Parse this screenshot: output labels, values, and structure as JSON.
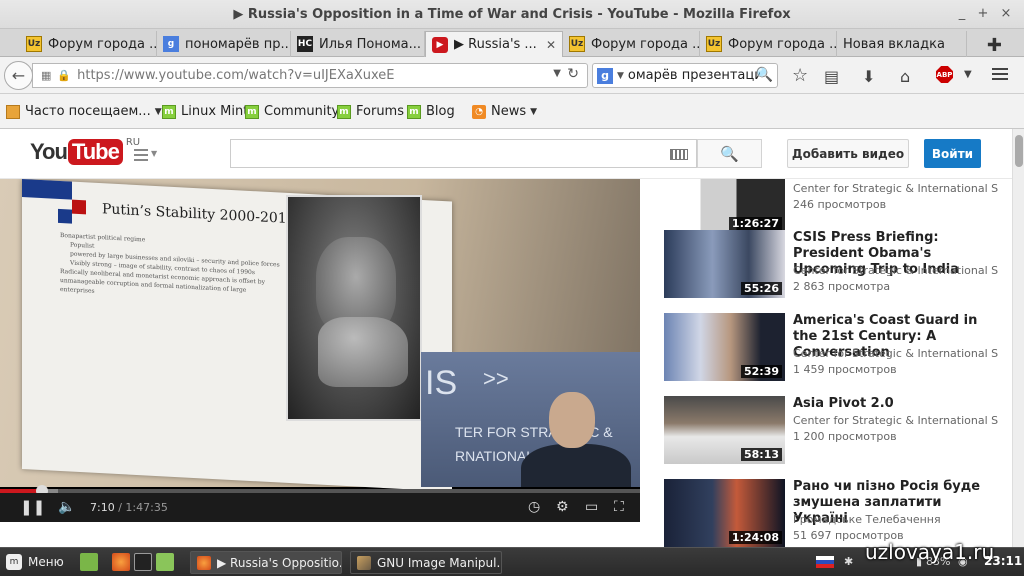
{
  "window": {
    "title": "▶ Russia's Opposition in a Time of War and Crisis - YouTube - Mozilla Firefox",
    "controls": [
      "_",
      "+",
      "×"
    ]
  },
  "tabs": [
    {
      "label": "Форум города ...",
      "icon": "uz-favicon",
      "active": false
    },
    {
      "label": "пономарёв пр...",
      "icon": "google-favicon",
      "active": false
    },
    {
      "label": "Илья Пономa...",
      "icon": "hc-favicon",
      "active": false
    },
    {
      "label": "▶ Russia's ...",
      "icon": "youtube-favicon",
      "active": true
    },
    {
      "label": "Форум города ...",
      "icon": "uz-favicon",
      "active": false
    },
    {
      "label": "Форум города ...",
      "icon": "uz-favicon",
      "active": false
    },
    {
      "label": "Новая вкладка",
      "icon": "",
      "active": false
    }
  ],
  "navbar": {
    "url": "https://www.youtube.com/watch?v=uIJEXaXuxeE",
    "search_value": "омарёв презентация"
  },
  "bookmarks": [
    {
      "label": "Часто посещаем...",
      "icon": "folder-icon",
      "dropdown": true
    },
    {
      "label": "Linux Mint",
      "icon": "mint-icon",
      "dropdown": false
    },
    {
      "label": "Community",
      "icon": "mint-icon",
      "dropdown": false
    },
    {
      "label": "Forums",
      "icon": "mint-icon",
      "dropdown": false
    },
    {
      "label": "Blog",
      "icon": "mint-icon",
      "dropdown": false
    },
    {
      "label": "News",
      "icon": "rss-icon",
      "dropdown": true
    }
  ],
  "youtube": {
    "logo_you": "You",
    "logo_tube": "Tube",
    "logo_region": "RU",
    "upload_label": "Добавить видео",
    "signin_label": "Войти",
    "accent": "#cc181e",
    "signin_color": "#167ac6"
  },
  "player": {
    "slide_title": "Putin’s Stability 2000-2013",
    "slide_lines": [
      "Bonapartist political regime",
      "Populist",
      "powered by large businesses and siloviki – security and police forces",
      "Visibly strong – image of stability, contrast to chaos of 1990s",
      "Radically neoliberal and monetarist economic approach is offset by unmanageable corruption and formal nationalization of large enterprises"
    ],
    "inset_text1": "IS",
    "inset_text2": ">>",
    "inset_text3": "TER FOR STRATEGIC &",
    "inset_text4": "RNATIONAL",
    "current_time": "7:10",
    "separator": "/",
    "duration": "1:47:35",
    "played_fraction": 0.066,
    "buffered_fraction": 0.09
  },
  "related": [
    {
      "title": "",
      "channel": "Center for Strategic & International Studies",
      "views": "246 просмотров",
      "duration": "1:26:27"
    },
    {
      "title": "CSIS Press Briefing: President Obama's Upcoming Trip to India",
      "channel": "Center for Strategic & International Studies",
      "views": "2 863 просмотра",
      "duration": "55:26"
    },
    {
      "title": "America's Coast Guard in the 21st Century: A Conversation",
      "channel": "Center for Strategic & International Studies",
      "views": "1 459 просмотров",
      "duration": "52:39"
    },
    {
      "title": "Asia Pivot 2.0",
      "channel": "Center for Strategic & International Studies",
      "views": "1 200 просмотров",
      "duration": "58:13"
    },
    {
      "title": "Рано чи пізно Росія буде змушена заплатити Україні",
      "channel": "Громадське Телебачення",
      "views": "51 697 просмотров",
      "duration": "1:24:08"
    }
  ],
  "taskbar": {
    "menu_label": "Меню",
    "windows": [
      {
        "label": "▶ Russia's Oppositio...",
        "active": true
      },
      {
        "label": "GNU Image Manipul...",
        "active": false
      }
    ],
    "watermark": "uzlovaya1.ru",
    "battery": "83%",
    "clock": "23:11"
  }
}
